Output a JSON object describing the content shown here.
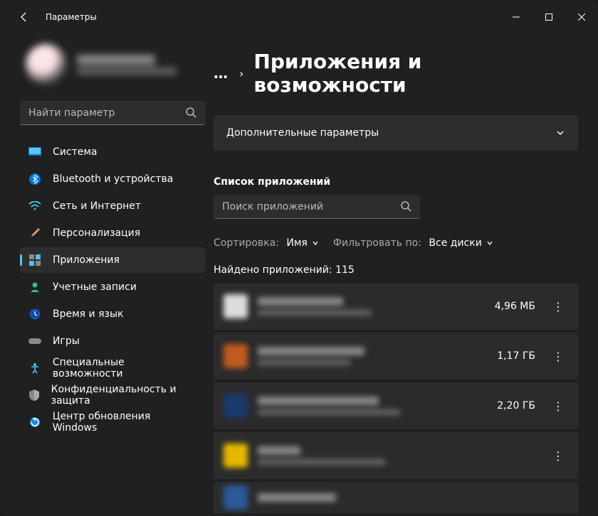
{
  "window": {
    "title": "Параметры"
  },
  "search": {
    "placeholder": "Найти параметр"
  },
  "sidebar": {
    "items": [
      {
        "label": "Система"
      },
      {
        "label": "Bluetooth и устройства"
      },
      {
        "label": "Сеть и Интернет"
      },
      {
        "label": "Персонализация"
      },
      {
        "label": "Приложения"
      },
      {
        "label": "Учетные записи"
      },
      {
        "label": "Время и язык"
      },
      {
        "label": "Игры"
      },
      {
        "label": "Специальные возможности"
      },
      {
        "label": "Конфиденциальность и защита"
      },
      {
        "label": "Центр обновления Windows"
      }
    ]
  },
  "main": {
    "page_title": "Приложения и возможности",
    "expand_label": "Дополнительные параметры",
    "list_header": "Список приложений",
    "app_search_placeholder": "Поиск приложений",
    "sort_label": "Сортировка:",
    "sort_value": "Имя",
    "filter_label": "Фильтровать по:",
    "filter_value": "Все диски",
    "count_text": "Найдено приложений: 115",
    "apps": [
      {
        "size": "4,96 МБ"
      },
      {
        "size": "1,17 ГБ"
      },
      {
        "size": "2,20 ГБ"
      },
      {
        "size": ""
      },
      {
        "size": ""
      }
    ]
  }
}
